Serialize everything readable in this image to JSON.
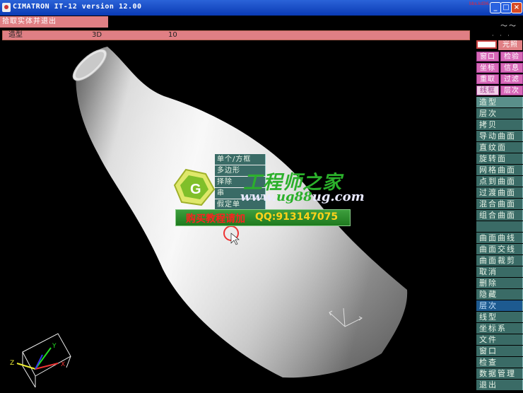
{
  "window": {
    "title": "CIMATRON IT-12 version 12.00",
    "corner_text": "bbs.kd36.net",
    "buttons": [
      "_",
      "□",
      "×"
    ]
  },
  "prompt": "拾取实体并退出",
  "status": {
    "mode": "造型",
    "view": "3D",
    "value": "10"
  },
  "popup_menu": [
    "单个/方框",
    "多边形",
    "择除",
    "串",
    "假定单"
  ],
  "watermark": {
    "title": "工程师之家",
    "url_a": "www.",
    "url_b": "ug88",
    "url_c": "ug.com",
    "buy": "购买教程请加",
    "qq": "QQ:913147075"
  },
  "right_panel": {
    "top_marks": "〜〜",
    "top_marks2": "· · ·",
    "light": "光照",
    "pairs": [
      [
        "窗口",
        "检验"
      ],
      [
        "坐标",
        "信息"
      ],
      [
        "重取",
        "过滤"
      ],
      [
        "线框",
        "层次"
      ]
    ],
    "menu": [
      "造型",
      "层次",
      "拷贝",
      "导动曲面",
      "直纹面",
      "旋转面",
      "网格曲面",
      "点到曲面",
      "过渡曲面",
      "混合曲面",
      "组合曲面",
      "",
      "曲面曲线",
      "曲面交线",
      "曲面裁剪",
      "取消",
      "删除",
      "隐藏",
      "层次",
      "线型",
      "坐标系",
      "文件",
      "窗口",
      "检查",
      "数据管理",
      "退出"
    ]
  },
  "triad_labels": {
    "x": "X",
    "y": "Y",
    "z": "Z"
  },
  "colors": {
    "title_bar": "#0a3ab4",
    "prompt_bg": "#e07f84",
    "menu_bg": "#3a6b66",
    "pair_bg": "#d868b8"
  }
}
